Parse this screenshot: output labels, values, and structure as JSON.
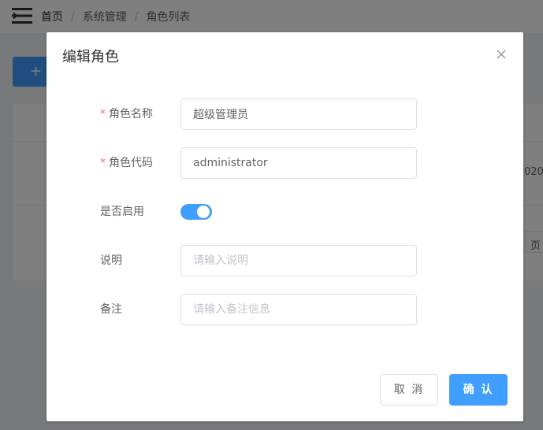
{
  "breadcrumb": {
    "home": "首页",
    "separator": "/",
    "section": "系统管理",
    "current": "角色列表"
  },
  "background": {
    "add_button_icon": "+",
    "date_snippet": "020",
    "pager_snippet": "页"
  },
  "dialog": {
    "title": "编辑角色",
    "close_icon": "close-icon",
    "required_mark": "*",
    "fields": {
      "role_name": {
        "label": "角色名称",
        "value": "超级管理员"
      },
      "role_code": {
        "label": "角色代码",
        "value": "administrator"
      },
      "enabled": {
        "label": "是否启用",
        "value": true
      },
      "description": {
        "label": "说明",
        "placeholder": "请输入说明"
      },
      "remark": {
        "label": "备注",
        "placeholder": "请输入备注信息"
      }
    },
    "buttons": {
      "cancel": "取 消",
      "confirm": "确 认"
    }
  },
  "colors": {
    "primary": "#409eff",
    "required": "#f56c6c"
  }
}
